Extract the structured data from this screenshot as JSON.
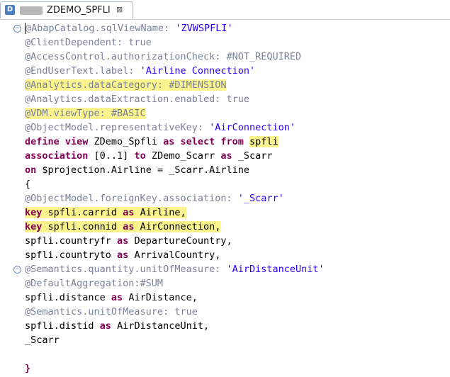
{
  "tab": {
    "icon_letter": "D",
    "title": "ZDEMO_SPFLI",
    "close_glyph": "⊠"
  },
  "colors": {
    "annotation": "#7a8199",
    "keyword": "#7f0055",
    "string": "#2a00ff",
    "highlight": "#fbf38e"
  },
  "code_lines": [
    {
      "fold": "minus",
      "hl": false,
      "tokens": [
        [
          "anno",
          "@AbapCatalog.sqlViewName: "
        ],
        [
          "str",
          "'ZVWSPFLI'"
        ]
      ]
    },
    {
      "fold": null,
      "hl": false,
      "tokens": [
        [
          "anno",
          "@ClientDependent: true"
        ]
      ]
    },
    {
      "fold": null,
      "hl": false,
      "tokens": [
        [
          "anno",
          "@AccessControl.authorizationCheck: #NOT_REQUIRED"
        ]
      ]
    },
    {
      "fold": null,
      "hl": false,
      "tokens": [
        [
          "anno",
          "@EndUserText.label: "
        ],
        [
          "str",
          "'Airline Connection'"
        ]
      ]
    },
    {
      "fold": null,
      "hl": true,
      "tokens": [
        [
          "anno",
          "@Analytics.dataCategory: #DIMENSION"
        ]
      ]
    },
    {
      "fold": null,
      "hl": false,
      "tokens": [
        [
          "anno",
          "@Analytics.dataExtraction.enabled: true"
        ]
      ]
    },
    {
      "fold": null,
      "hl": true,
      "tokens": [
        [
          "anno",
          "@VDM.viewType: #BASIC"
        ]
      ]
    },
    {
      "fold": null,
      "hl": false,
      "tokens": [
        [
          "anno",
          "@ObjectModel.representativeKey: "
        ],
        [
          "str",
          "'AirConnection'"
        ]
      ]
    },
    {
      "fold": null,
      "hl": false,
      "tokens": [
        [
          "kw",
          "define view "
        ],
        [
          "txt",
          "ZDemo_Spfli "
        ],
        [
          "kw",
          "as select from "
        ],
        [
          "txt-hl",
          "spfli"
        ]
      ]
    },
    {
      "fold": null,
      "hl": false,
      "tokens": [
        [
          "kw",
          "association "
        ],
        [
          "txt",
          "[0..1] "
        ],
        [
          "kw",
          "to "
        ],
        [
          "txt",
          "ZDemo_Scarr "
        ],
        [
          "kw",
          "as "
        ],
        [
          "txt",
          "_Scarr"
        ]
      ]
    },
    {
      "fold": null,
      "hl": false,
      "tokens": [
        [
          "kw",
          "on "
        ],
        [
          "txt",
          "$projection.Airline = _Scarr.Airline"
        ]
      ]
    },
    {
      "fold": null,
      "hl": false,
      "tokens": [
        [
          "txt",
          "{"
        ]
      ]
    },
    {
      "fold": null,
      "hl": false,
      "tokens": [
        [
          "anno",
          "@ObjectModel.foreignKey.association: "
        ],
        [
          "str",
          "'_Scarr'"
        ]
      ]
    },
    {
      "fold": null,
      "hl": true,
      "tokens": [
        [
          "kw",
          "key "
        ],
        [
          "txt",
          "spfli.carrid "
        ],
        [
          "kw",
          "as "
        ],
        [
          "txt",
          "Airline,"
        ]
      ]
    },
    {
      "fold": null,
      "hl": true,
      "tokens": [
        [
          "kw",
          "key "
        ],
        [
          "txt",
          "spfli.connid "
        ],
        [
          "kw",
          "as "
        ],
        [
          "txt",
          "AirConnection,"
        ]
      ]
    },
    {
      "fold": null,
      "hl": false,
      "tokens": [
        [
          "txt",
          "spfli.countryfr "
        ],
        [
          "kw",
          "as "
        ],
        [
          "txt",
          "DepartureCountry,"
        ]
      ]
    },
    {
      "fold": null,
      "hl": false,
      "tokens": [
        [
          "txt",
          "spfli.countryto "
        ],
        [
          "kw",
          "as "
        ],
        [
          "txt",
          "ArrivalCountry,"
        ]
      ]
    },
    {
      "fold": "minus",
      "hl": false,
      "tokens": [
        [
          "anno",
          "@Semantics.quantity.unitOfMeasure: "
        ],
        [
          "str",
          "'AirDistanceUnit'"
        ]
      ]
    },
    {
      "fold": null,
      "hl": false,
      "tokens": [
        [
          "anno",
          "@DefaultAggregation:#SUM"
        ]
      ]
    },
    {
      "fold": null,
      "hl": false,
      "tokens": [
        [
          "txt",
          "spfli.distance "
        ],
        [
          "kw",
          "as "
        ],
        [
          "txt",
          "AirDistance,"
        ]
      ]
    },
    {
      "fold": null,
      "hl": false,
      "tokens": [
        [
          "anno",
          "@Semantics.unitOfMeasure: true"
        ]
      ]
    },
    {
      "fold": null,
      "hl": false,
      "tokens": [
        [
          "txt",
          "spfli.distid "
        ],
        [
          "kw",
          "as "
        ],
        [
          "txt",
          "AirDistanceUnit,"
        ]
      ]
    },
    {
      "fold": null,
      "hl": false,
      "tokens": [
        [
          "txt",
          "_Scarr"
        ]
      ]
    },
    {
      "fold": null,
      "hl": false,
      "tokens": []
    },
    {
      "fold": null,
      "hl": false,
      "tokens": [
        [
          "kw",
          "}"
        ]
      ]
    }
  ]
}
